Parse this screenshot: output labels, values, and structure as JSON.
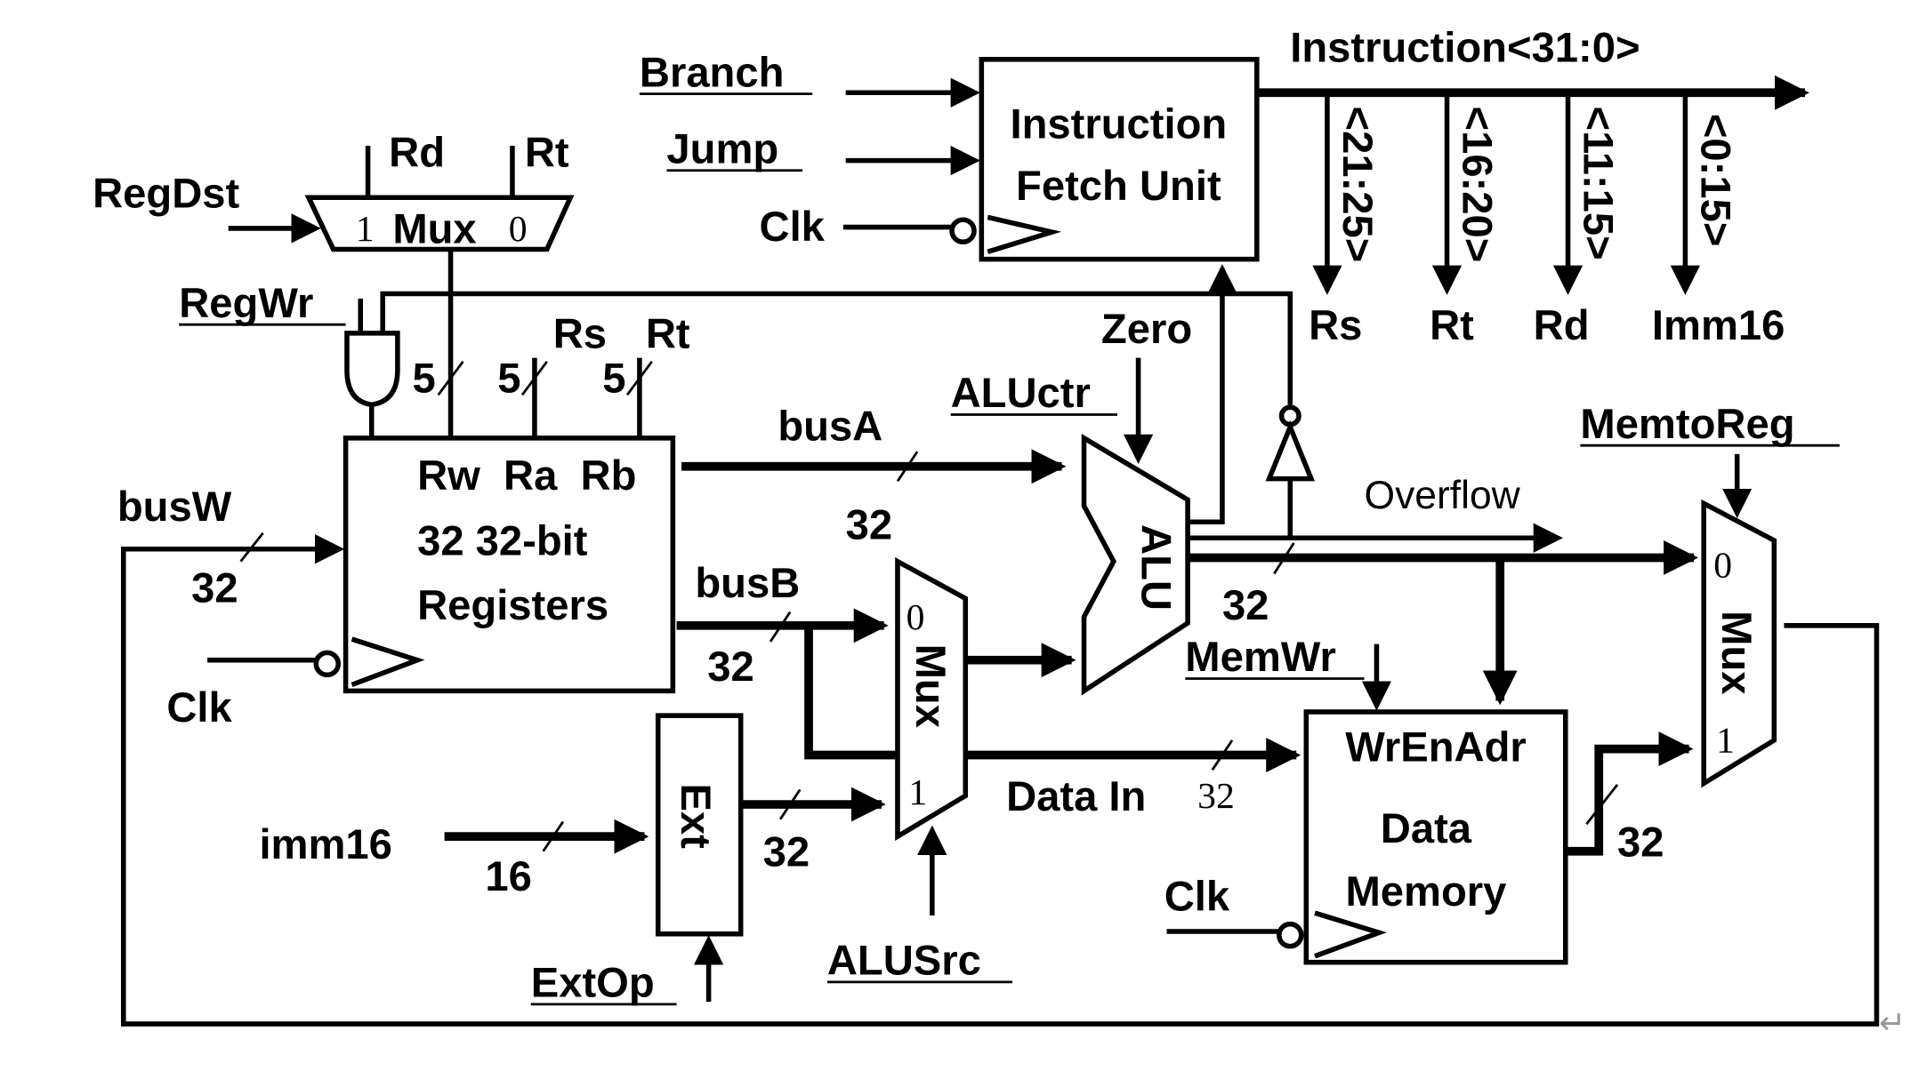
{
  "ifu": {
    "line1": "Instruction",
    "line2": "Fetch Unit"
  },
  "controls": {
    "branch": "Branch",
    "jump": "Jump",
    "regdst": "RegDst",
    "regwr": "RegWr",
    "aluctr": "ALUctr",
    "memtoreg": "MemtoReg",
    "memwr": "MemWr",
    "alusrc": "ALUSrc",
    "extop": "ExtOp"
  },
  "clk": "Clk",
  "instruction_bus": {
    "label": "Instruction<31:0>",
    "fields": [
      {
        "bits": "<21:25>",
        "name": "Rs"
      },
      {
        "bits": "<16:20>",
        "name": "Rt"
      },
      {
        "bits": "<11:15>",
        "name": "Rd"
      },
      {
        "bits": "<0:15>",
        "name": "Imm16"
      }
    ]
  },
  "regdst_mux": {
    "in1": "1",
    "label": "Mux",
    "in0": "0",
    "rd": "Rd",
    "rt": "Rt"
  },
  "registers": {
    "ports": "Rw  Ra  Rb",
    "line2": "32 32-bit",
    "line3": "Registers",
    "rs": "Rs",
    "rt": "Rt",
    "width5": "5"
  },
  "buses": {
    "busA": "busA",
    "busB": "busB",
    "busW": "busW",
    "w32": "32",
    "w16": "16",
    "data_in": "Data In",
    "data_in_width": "32",
    "overflow": "Overflow",
    "zero": "Zero"
  },
  "alu": {
    "label": "ALU"
  },
  "alusrc_mux": {
    "in0": "0",
    "label": "Mux",
    "in1": "1"
  },
  "ext": {
    "label": "Ext",
    "input": "imm16"
  },
  "data_memory": {
    "ports": "WrEnAdr",
    "line2": "Data",
    "line3": "Memory"
  },
  "memtoreg_mux": {
    "in0": "0",
    "label": "Mux",
    "in1": "1"
  },
  "return_mark": "↵"
}
